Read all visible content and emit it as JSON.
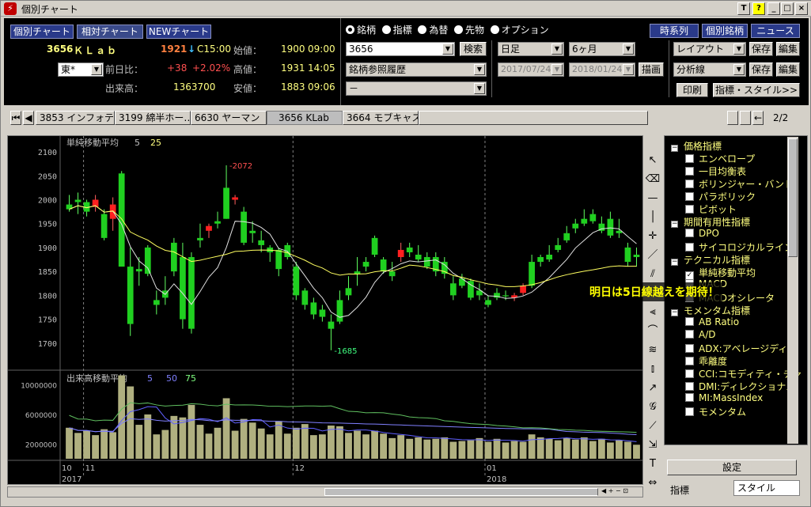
{
  "window": {
    "title": "個別チャート",
    "btn_t": "T",
    "btn_help": "?",
    "btn_min": "_",
    "btn_max": "□",
    "btn_close": "×"
  },
  "header": {
    "tabs": [
      "個別チャート",
      "相対チャート",
      "NEWチャート"
    ],
    "stock_code": "3656",
    "stock_name": "ＫＬａｂ",
    "market": "東*",
    "price": "1921",
    "arrow": "↓",
    "c_time": "C15:00",
    "prev_label": "前日比：",
    "prev_change": "+38",
    "prev_pct": "+2.02%",
    "volume_label": "出来高：",
    "volume": "1363700",
    "open_label": "始値：",
    "open_val": "1900",
    "open_time": "09:00",
    "high_label": "高値：",
    "high_val": "1931",
    "high_time": "14:05",
    "low_label": "安値：",
    "low_val": "1883",
    "low_time": "09:06",
    "radio_options": [
      "銘柄",
      "指標",
      "為替",
      "先物",
      "オプション"
    ],
    "code_input": "3656",
    "search_btn": "検索",
    "history_select": "銘柄参照履歴",
    "third_select": "－",
    "period_select": "日足",
    "range_select": "6ヶ月",
    "date_from": "2017/07/24",
    "date_to": "2018/01/24",
    "draw_btn": "描画",
    "right_btns": [
      "時系列",
      "個別銘柄",
      "ニュース"
    ],
    "layout_select": "レイアウト",
    "save_btn": "保存",
    "edit_btn": "編集",
    "analysis_select": "分析線",
    "print_btn": "印刷",
    "indicator_style_btn": "指標・スタイル>>"
  },
  "tabbar": {
    "tabs": [
      "3853 インフォテリ",
      "3199 綿半ホー…",
      "6630 ヤーマン",
      "3656 KLab",
      "3664 モブキャス"
    ],
    "page": "2/2"
  },
  "chart_data": {
    "type": "candlestick",
    "title": "単純移動平均",
    "ma_periods": [
      "5",
      "25"
    ],
    "ylim": [
      1650,
      2120
    ],
    "yticks": [
      1700,
      1750,
      1800,
      1850,
      1900,
      1950,
      2000,
      2050,
      2100
    ],
    "annotations": [
      {
        "label": "-2072",
        "value": 2072
      },
      {
        "label": "-1685",
        "value": 1685
      }
    ],
    "x_labels": [
      "10",
      "11",
      "12",
      "01"
    ],
    "year_labels": [
      "2017",
      "2018"
    ],
    "candles": [
      [
        1990,
        2010,
        1975,
        1980
      ],
      [
        2000,
        2015,
        1970,
        1995
      ],
      [
        1995,
        2000,
        1965,
        1975
      ],
      [
        1985,
        2010,
        1975,
        2000
      ],
      [
        1970,
        1980,
        1915,
        1920
      ],
      [
        1960,
        2005,
        1935,
        1990
      ],
      [
        2055,
        2060,
        1870,
        1860
      ],
      [
        1860,
        1900,
        1715,
        1740
      ],
      [
        1855,
        1880,
        1820,
        1850
      ],
      [
        1900,
        1905,
        1840,
        1845
      ],
      [
        1790,
        1810,
        1760,
        1780
      ],
      [
        1810,
        1840,
        1780,
        1795
      ],
      [
        1910,
        1920,
        1840,
        1850
      ],
      [
        1880,
        1910,
        1730,
        1750
      ],
      [
        1880,
        1890,
        1720,
        1730
      ],
      [
        1920,
        1950,
        1900,
        1915
      ],
      [
        1935,
        1950,
        1920,
        1945
      ],
      [
        1955,
        1975,
        1940,
        1950
      ],
      [
        2025,
        2072,
        1960,
        1960
      ],
      [
        2000,
        2010,
        1990,
        2005
      ],
      [
        1975,
        1985,
        1905,
        1910
      ],
      [
        1935,
        1955,
        1910,
        1930
      ],
      [
        1915,
        1935,
        1890,
        1905
      ],
      [
        1900,
        1905,
        1870,
        1890
      ],
      [
        1895,
        1900,
        1840,
        1855
      ],
      [
        1905,
        1910,
        1875,
        1880
      ],
      [
        1860,
        1870,
        1790,
        1800
      ],
      [
        1810,
        1815,
        1770,
        1780
      ],
      [
        1785,
        1795,
        1750,
        1760
      ],
      [
        1770,
        1780,
        1745,
        1755
      ],
      [
        1745,
        1760,
        1685,
        1730
      ],
      [
        1790,
        1810,
        1740,
        1745
      ],
      [
        1815,
        1840,
        1790,
        1800
      ],
      [
        1850,
        1880,
        1820,
        1845
      ],
      [
        1870,
        1880,
        1850,
        1860
      ],
      [
        1920,
        1925,
        1880,
        1885
      ],
      [
        1875,
        1880,
        1845,
        1850
      ],
      [
        1850,
        1870,
        1830,
        1840
      ],
      [
        1880,
        1910,
        1870,
        1895
      ],
      [
        1900,
        1910,
        1880,
        1890
      ],
      [
        1885,
        1905,
        1870,
        1875
      ],
      [
        1880,
        1890,
        1855,
        1860
      ],
      [
        1880,
        1890,
        1840,
        1850
      ],
      [
        1870,
        1880,
        1835,
        1845
      ],
      [
        1825,
        1840,
        1790,
        1800
      ],
      [
        1835,
        1845,
        1815,
        1820
      ],
      [
        1830,
        1835,
        1790,
        1795
      ],
      [
        1810,
        1825,
        1790,
        1800
      ],
      [
        1790,
        1800,
        1775,
        1780
      ],
      [
        1805,
        1815,
        1790,
        1795
      ],
      [
        1800,
        1810,
        1790,
        1798
      ],
      [
        1795,
        1805,
        1788,
        1800
      ],
      [
        1805,
        1825,
        1800,
        1820
      ],
      [
        1870,
        1885,
        1815,
        1820
      ],
      [
        1880,
        1885,
        1860,
        1870
      ],
      [
        1885,
        1905,
        1870,
        1875
      ],
      [
        1905,
        1920,
        1890,
        1895
      ],
      [
        1930,
        1945,
        1910,
        1915
      ],
      [
        1950,
        1960,
        1930,
        1940
      ],
      [
        1960,
        1980,
        1945,
        1950
      ],
      [
        1970,
        1980,
        1950,
        1955
      ],
      [
        1950,
        1965,
        1930,
        1935
      ],
      [
        1960,
        1975,
        1920,
        1925
      ],
      [
        1935,
        1960,
        1920,
        1930
      ],
      [
        1900,
        1910,
        1860,
        1870
      ],
      [
        1885,
        1900,
        1860,
        1880
      ]
    ]
  },
  "volume_chart": {
    "title": "出来高移動平均",
    "ma_periods": [
      "5",
      "50",
      "75"
    ],
    "yticks": [
      "10000000",
      "6000000",
      "2000000"
    ]
  },
  "callout": "明日は5日線越えを期待！",
  "tree": [
    {
      "type": "group",
      "label": "価格指標"
    },
    {
      "type": "item",
      "label": "エンベロープ",
      "checked": false
    },
    {
      "type": "item",
      "label": "一目均衡表",
      "checked": false
    },
    {
      "type": "item",
      "label": "ボリンジャー・バンド",
      "checked": false
    },
    {
      "type": "item",
      "label": "パラボリック",
      "checked": false
    },
    {
      "type": "item",
      "label": "ピボット",
      "checked": false
    },
    {
      "type": "group",
      "label": "期間有用性指標"
    },
    {
      "type": "item",
      "label": "DPO",
      "checked": false
    },
    {
      "type": "item",
      "label": "サイコロジカルライン",
      "checked": false
    },
    {
      "type": "group",
      "label": "テクニカル指標"
    },
    {
      "type": "item",
      "label": "単純移動平均",
      "checked": true
    },
    {
      "type": "item",
      "label": "MACD",
      "checked": false
    },
    {
      "type": "item",
      "label": "MACDオシレータ",
      "checked": false
    },
    {
      "type": "group",
      "label": "モメンタム指標"
    },
    {
      "type": "item",
      "label": "AB Ratio",
      "checked": false
    },
    {
      "type": "item",
      "label": "A/D",
      "checked": false
    },
    {
      "type": "item",
      "label": "ADX:アベレージディレ",
      "checked": false
    },
    {
      "type": "item",
      "label": "乖離度",
      "checked": false
    },
    {
      "type": "item",
      "label": "CCI:コモディティ・チャ",
      "checked": false
    },
    {
      "type": "item",
      "label": "DMI:ディレクショナル",
      "checked": false
    },
    {
      "type": "item",
      "label": "MI:MassIndex",
      "checked": false
    },
    {
      "type": "item",
      "label": "モメンタム",
      "checked": false
    }
  ],
  "settings_btn": "設定",
  "bottom_tabs": [
    "指標",
    "スタイル"
  ]
}
